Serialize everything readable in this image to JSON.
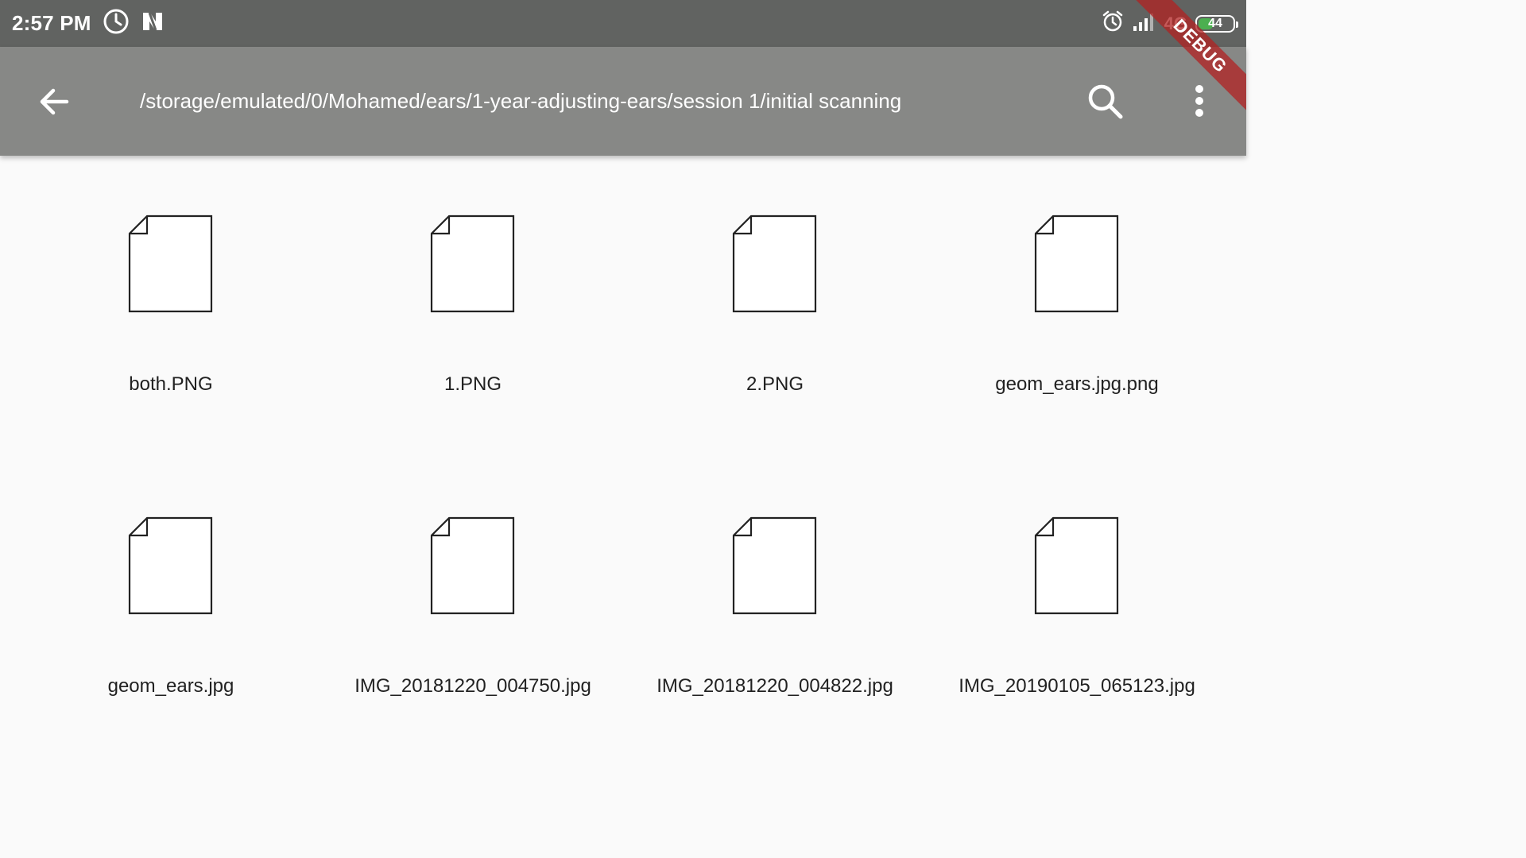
{
  "status_bar": {
    "time": "2:57 PM",
    "network_type": "4G",
    "battery_level": "44",
    "battery_color": "#4caf50"
  },
  "app_bar": {
    "path": "/storage/emulated/0/Mohamed/ears/1-year-adjusting-ears/session 1/initial scanning",
    "back_icon": "arrow-left-icon",
    "search_icon": "search-icon",
    "more_icon": "more-vertical-icon",
    "background": "#878886"
  },
  "debug_banner": "DEBUG",
  "files": [
    {
      "name": "both.PNG",
      "icon": "file-icon"
    },
    {
      "name": "1.PNG",
      "icon": "file-icon"
    },
    {
      "name": "2.PNG",
      "icon": "file-icon"
    },
    {
      "name": "geom_ears.jpg.png",
      "icon": "file-icon"
    },
    {
      "name": "geom_ears.jpg",
      "icon": "file-icon"
    },
    {
      "name": "IMG_20181220_004750.jpg",
      "icon": "file-icon"
    },
    {
      "name": "IMG_20181220_004822.jpg",
      "icon": "file-icon"
    },
    {
      "name": "IMG_20190105_065123.jpg",
      "icon": "file-icon"
    }
  ]
}
